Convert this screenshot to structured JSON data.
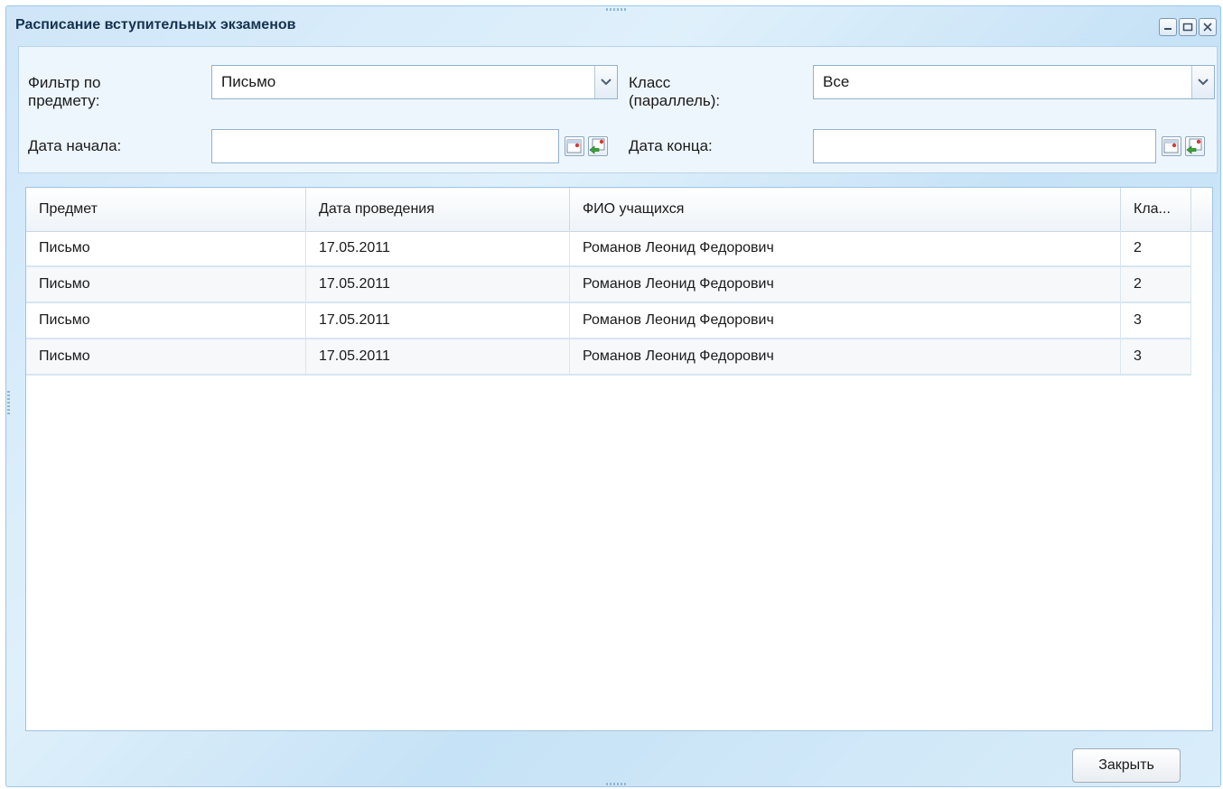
{
  "window": {
    "title": "Расписание вступительных экзаменов",
    "tools": [
      "minimize-icon",
      "maximize-icon",
      "close-icon"
    ]
  },
  "filters": {
    "subject_label_line1": "Фильтр по",
    "subject_label_line2": "предмету:",
    "subject_value": "Письмо",
    "class_label_line1": "Класс",
    "class_label_line2": "(параллель):",
    "class_value": "Все",
    "start_label": "Дата начала:",
    "start_value": "",
    "end_label": "Дата конца:",
    "end_value": ""
  },
  "grid": {
    "columns": [
      "Предмет",
      "Дата проведения",
      "ФИО учащихся",
      "Кла..."
    ],
    "rows": [
      [
        "Письмо",
        "17.05.2011",
        "Романов Леонид Федорович",
        "2"
      ],
      [
        "Письмо",
        "17.05.2011",
        "Романов Леонид Федорович",
        "2"
      ],
      [
        "Письмо",
        "17.05.2011",
        "Романов Леонид Федорович",
        "3"
      ],
      [
        "Письмо",
        "17.05.2011",
        "Романов Леонид Федорович",
        "3"
      ]
    ]
  },
  "footer": {
    "close_label": "Закрыть"
  }
}
